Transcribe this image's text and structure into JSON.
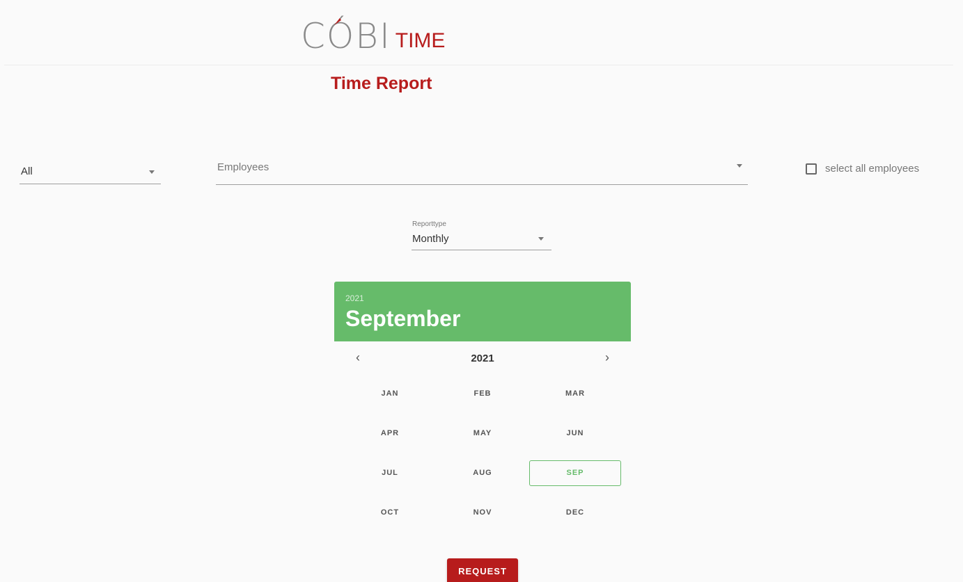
{
  "logo": {
    "brand": "CÓBI",
    "product": "TIME",
    "accent_color": "#b71c1c"
  },
  "page": {
    "title": "Time Report"
  },
  "filter": {
    "group_value": "All",
    "employees_placeholder": "Employees",
    "select_all_label": "select all employees",
    "select_all_checked": false
  },
  "reporttype": {
    "label": "Reporttype",
    "value": "Monthly"
  },
  "picker": {
    "header_year": "2021",
    "header_month": "September",
    "nav_year": "2021",
    "prev_icon": "‹",
    "next_icon": "›",
    "accent_color": "#66bb6a",
    "selected": "SEP",
    "months": [
      "JAN",
      "FEB",
      "MAR",
      "APR",
      "MAY",
      "JUN",
      "JUL",
      "AUG",
      "SEP",
      "OCT",
      "NOV",
      "DEC"
    ]
  },
  "actions": {
    "request_label": "REQUEST"
  }
}
